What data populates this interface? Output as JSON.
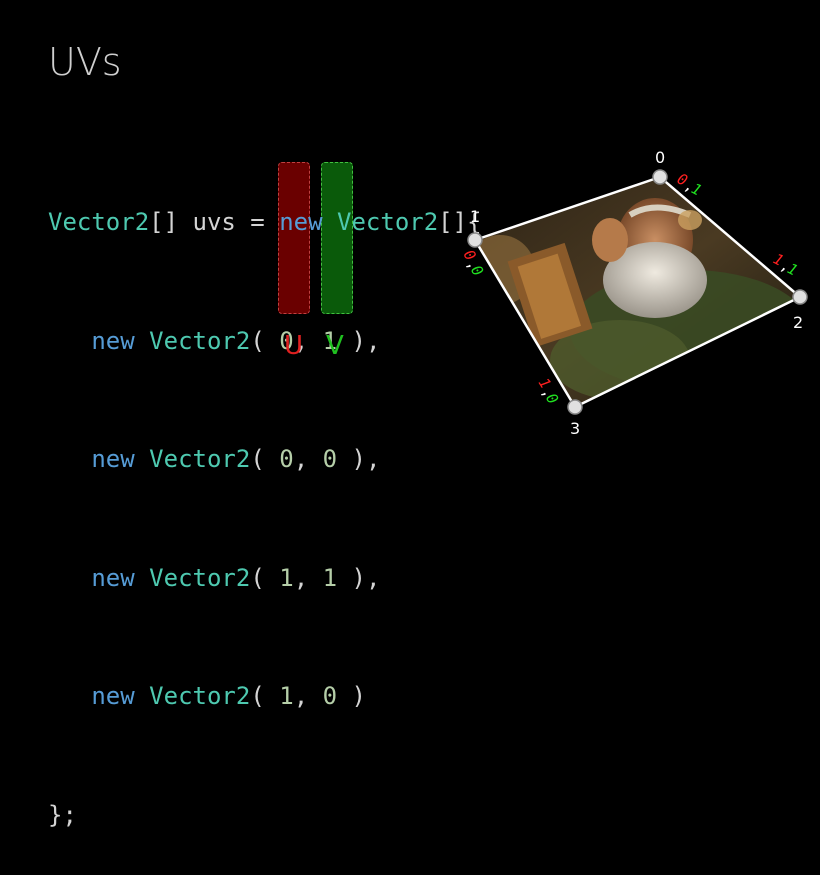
{
  "title": "UVs",
  "code": {
    "line1": {
      "type": "Vector2",
      "mid": "[] uvs = ",
      "kw": "new",
      "type2": "Vector2",
      "end": "[]{"
    },
    "rows": [
      {
        "kw": "new",
        "type": "Vector2",
        "open": "(",
        "u": "0",
        "v": "1",
        "close": "),"
      },
      {
        "kw": "new",
        "type": "Vector2",
        "open": "(",
        "u": "0",
        "v": "0",
        "close": "),"
      },
      {
        "kw": "new",
        "type": "Vector2",
        "open": "(",
        "u": "1",
        "v": "1",
        "close": "),"
      },
      {
        "kw": "new",
        "type": "Vector2",
        "open": "(",
        "u": "1",
        "v": "0",
        "close": ")"
      }
    ],
    "last": "};"
  },
  "labels": {
    "u": "U",
    "v": "V"
  },
  "vertices": [
    {
      "index": "0",
      "u": "0",
      "v": "1"
    },
    {
      "index": "1",
      "u": "0",
      "v": "0"
    },
    {
      "index": "2",
      "u": "1",
      "v": "1"
    },
    {
      "index": "3",
      "u": "1",
      "v": "0"
    }
  ],
  "colors": {
    "u": "#e02020",
    "v": "#20c020",
    "keyword": "#569cd6",
    "type": "#4ec9b0"
  }
}
